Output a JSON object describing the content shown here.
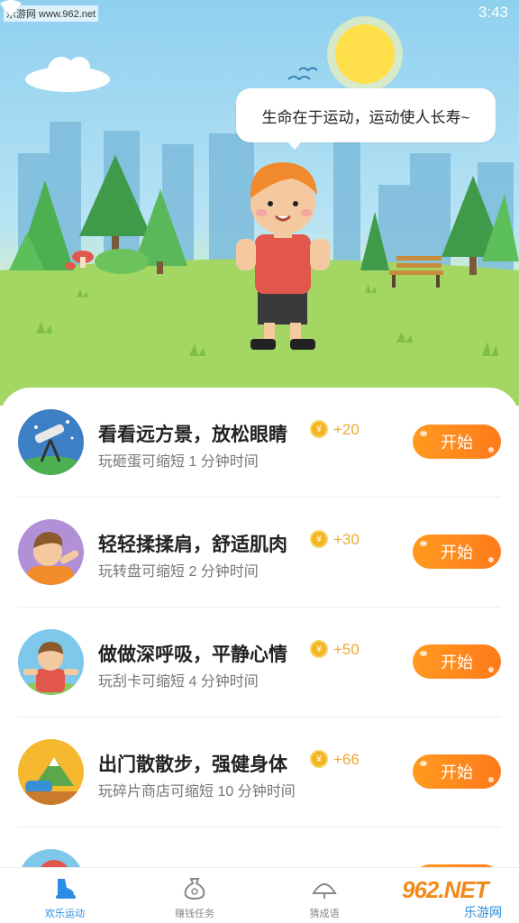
{
  "status_bar": {
    "time": "3:43",
    "watermark_top": "乐游网 www.962.net"
  },
  "hero": {
    "speech": "生命在于运动，运动使人长寿~"
  },
  "tasks": [
    {
      "title": "看看远方景，放松眼睛",
      "reward": "+20",
      "desc": "玩砸蛋可缩短 1 分钟时间",
      "button": "开始",
      "avatar": "telescope-avatar"
    },
    {
      "title": "轻轻揉揉肩，舒适肌肉",
      "reward": "+30",
      "desc": "玩转盘可缩短 2 分钟时间",
      "button": "开始",
      "avatar": "shoulder-avatar"
    },
    {
      "title": "做做深呼吸，平静心情",
      "reward": "+50",
      "desc": "玩刮卡可缩短 4 分钟时间",
      "button": "开始",
      "avatar": "breathing-avatar"
    },
    {
      "title": "出门散散步，强健身体",
      "reward": "+66",
      "desc": "玩碎片商店可缩短 10 分钟时间",
      "button": "开始",
      "avatar": "walking-avatar"
    },
    {
      "title": "",
      "reward": "",
      "desc": "",
      "button": "",
      "avatar": "partial-avatar"
    }
  ],
  "nav": {
    "items": [
      {
        "label": "欢乐运动",
        "icon": "shoe-icon",
        "active": true
      },
      {
        "label": "赚钱任务",
        "icon": "money-bag-icon",
        "active": false
      },
      {
        "label": "猜成语",
        "icon": "idiom-fan-icon",
        "active": false
      }
    ]
  },
  "watermark": {
    "big": "962.NET",
    "small": "乐游网"
  },
  "colors": {
    "accent_orange": "#ff8a1e",
    "coin": "#f3b622",
    "nav_active": "#2b8de8"
  }
}
